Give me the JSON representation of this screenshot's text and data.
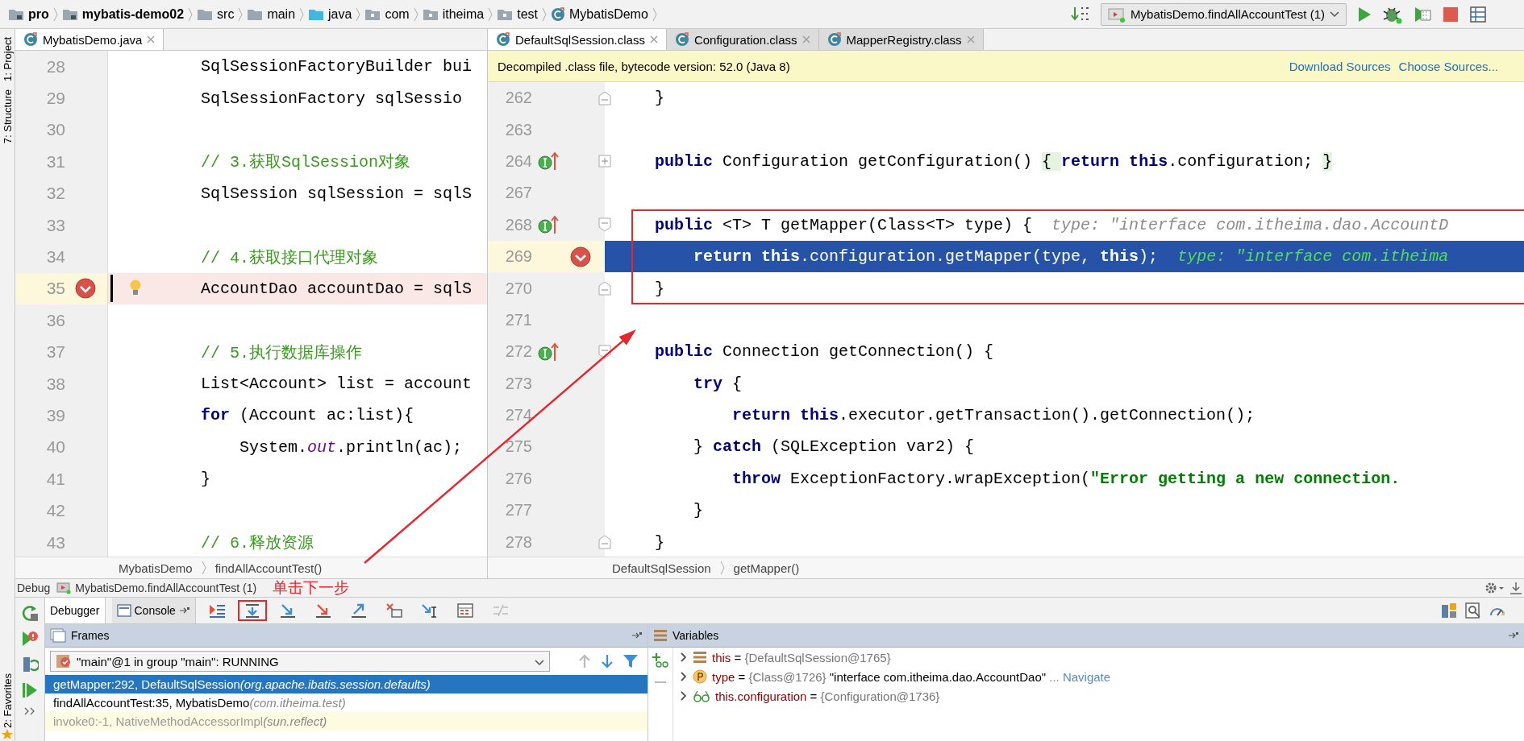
{
  "breadcrumbs": [
    {
      "label": "pro",
      "kind": "module"
    },
    {
      "label": "mybatis-demo02",
      "kind": "module"
    },
    {
      "label": "src",
      "kind": "folder"
    },
    {
      "label": "main",
      "kind": "folder"
    },
    {
      "label": "java",
      "kind": "source"
    },
    {
      "label": "com",
      "kind": "package"
    },
    {
      "label": "itheima",
      "kind": "package"
    },
    {
      "label": "test",
      "kind": "package"
    },
    {
      "label": "MybatisDemo",
      "kind": "class"
    }
  ],
  "run_config": {
    "label": "MybatisDemo.findAllAccountTest (1)"
  },
  "tool_strip": {
    "top": [
      "1: Project",
      "7: Structure"
    ],
    "bottom": [
      "2: Favorites"
    ]
  },
  "left_editor": {
    "tabs": [
      {
        "label": "MybatisDemo.java",
        "selected": true
      }
    ],
    "lines": [
      {
        "number": "28",
        "breakpoint": false,
        "current": false,
        "tokens": [
          {
            "kind": "plain",
            "text": "SqlSessionFactoryBuilder bui"
          }
        ]
      },
      {
        "number": "29",
        "breakpoint": false,
        "current": false,
        "tokens": [
          {
            "kind": "plain",
            "text": "SqlSessionFactory sqlSessio"
          }
        ]
      },
      {
        "number": "30",
        "breakpoint": false,
        "current": false
      },
      {
        "number": "31",
        "breakpoint": false,
        "current": false,
        "tokens": [
          {
            "kind": "comment",
            "text": "// 3.获取SqlSession对象"
          }
        ]
      },
      {
        "number": "32",
        "breakpoint": false,
        "current": false,
        "tokens": [
          {
            "kind": "plain",
            "text": "SqlSession sqlSession = sqlS"
          }
        ]
      },
      {
        "number": "33",
        "breakpoint": false,
        "current": false
      },
      {
        "number": "34",
        "breakpoint": false,
        "current": false,
        "tokens": [
          {
            "kind": "comment",
            "text": "// 4.获取接口代理对象"
          }
        ]
      },
      {
        "number": "35",
        "breakpoint": true,
        "current": true,
        "bulb": true,
        "tokens": [
          {
            "kind": "plain",
            "text": "AccountDao accountDao = sqlS"
          }
        ]
      },
      {
        "number": "36",
        "breakpoint": false,
        "current": false
      },
      {
        "number": "37",
        "breakpoint": false,
        "current": false,
        "tokens": [
          {
            "kind": "comment",
            "text": "// 5.执行数据库操作"
          }
        ]
      },
      {
        "number": "38",
        "breakpoint": false,
        "current": false,
        "tokens": [
          {
            "kind": "plain",
            "text": "List<Account> list = account"
          }
        ]
      },
      {
        "number": "39",
        "breakpoint": false,
        "current": false,
        "tokens": [
          {
            "kind": "keyword",
            "text": "for"
          },
          {
            "kind": "plain",
            "text": " (Account ac:list){"
          }
        ]
      },
      {
        "number": "40",
        "breakpoint": false,
        "current": false,
        "tokens": [
          {
            "kind": "plain",
            "text": "    System."
          },
          {
            "kind": "static",
            "text": "out"
          },
          {
            "kind": "plain",
            "text": ".println(ac);"
          }
        ]
      },
      {
        "number": "41",
        "breakpoint": false,
        "current": false,
        "tokens": [
          {
            "kind": "plain",
            "text": "}"
          }
        ]
      },
      {
        "number": "42",
        "breakpoint": false,
        "current": false
      },
      {
        "number": "43",
        "breakpoint": false,
        "current": false,
        "tokens": [
          {
            "kind": "comment",
            "text": "// 6.释放资源"
          }
        ]
      }
    ],
    "breadcrumb": [
      "MybatisDemo",
      "findAllAccountTest()"
    ]
  },
  "right_editor": {
    "tabs": [
      {
        "label": "DefaultSqlSession.class",
        "selected": true
      },
      {
        "label": "Configuration.class",
        "selected": false
      },
      {
        "label": "MapperRegistry.class",
        "selected": false
      }
    ],
    "banner": {
      "text": "Decompiled .class file, bytecode version: 52.0 (Java 8)",
      "links": [
        "Download Sources",
        "Choose Sources..."
      ]
    },
    "lines": [
      {
        "number": "262",
        "breakpoint": false,
        "current": false,
        "boxed": false,
        "fold_end": true,
        "tokens": [
          {
            "kind": "plain",
            "text": "}"
          }
        ]
      },
      {
        "number": "263",
        "breakpoint": false,
        "current": false,
        "boxed": false
      },
      {
        "number": "264",
        "breakpoint": false,
        "current": false,
        "boxed": false,
        "implemented": true,
        "collapsed": true,
        "tokens": [
          {
            "kind": "keyword",
            "text": "public"
          },
          {
            "kind": "plain",
            "text": " Configuration getConfiguration() "
          },
          {
            "kind": "brace",
            "text": "{ "
          },
          {
            "kind": "keyword",
            "text": "return this"
          },
          {
            "kind": "plain",
            "text": ".configuration; "
          },
          {
            "kind": "brace",
            "text": "}"
          }
        ]
      },
      {
        "number": "267",
        "breakpoint": false,
        "current": false,
        "boxed": false
      },
      {
        "number": "268",
        "breakpoint": false,
        "current": false,
        "boxed": true,
        "implemented": true,
        "fold_start": true,
        "tokens": [
          {
            "kind": "keyword",
            "text": "public"
          },
          {
            "kind": "plain",
            "text": " <T> T getMapper(Class<T> type) {"
          },
          {
            "kind": "hint",
            "text": "  type: \"interface com.itheima.dao.AccountD"
          }
        ]
      },
      {
        "number": "269",
        "breakpoint": true,
        "current": true,
        "boxed": true,
        "tokens": [
          {
            "kind": "keyword",
            "text": "    return this"
          },
          {
            "kind": "plain",
            "text": ".configuration.getMapper(type, "
          },
          {
            "kind": "keyword",
            "text": "this"
          },
          {
            "kind": "plain",
            "text": ");"
          },
          {
            "kind": "hint",
            "text": "  type: \"interface com.itheima"
          }
        ]
      },
      {
        "number": "270",
        "breakpoint": false,
        "current": false,
        "boxed": true,
        "fold_end": true,
        "tokens": [
          {
            "kind": "plain",
            "text": "}"
          }
        ]
      },
      {
        "number": "271",
        "breakpoint": false,
        "current": false,
        "boxed": false
      },
      {
        "number": "272",
        "breakpoint": false,
        "current": false,
        "boxed": false,
        "implemented": true,
        "fold_start": true,
        "tokens": [
          {
            "kind": "keyword",
            "text": "public"
          },
          {
            "kind": "plain",
            "text": " Connection getConnection() {"
          }
        ]
      },
      {
        "number": "273",
        "breakpoint": false,
        "current": false,
        "boxed": false,
        "tokens": [
          {
            "kind": "keyword",
            "text": "    try"
          },
          {
            "kind": "plain",
            "text": " {"
          }
        ]
      },
      {
        "number": "274",
        "breakpoint": false,
        "current": false,
        "boxed": false,
        "tokens": [
          {
            "kind": "keyword",
            "text": "        return this"
          },
          {
            "kind": "plain",
            "text": ".executor.getTransaction().getConnection();"
          }
        ]
      },
      {
        "number": "275",
        "breakpoint": false,
        "current": false,
        "boxed": false,
        "tokens": [
          {
            "kind": "plain",
            "text": "    } "
          },
          {
            "kind": "keyword",
            "text": "catch"
          },
          {
            "kind": "plain",
            "text": " (SQLException var2) {"
          }
        ]
      },
      {
        "number": "276",
        "breakpoint": false,
        "current": false,
        "boxed": false,
        "tokens": [
          {
            "kind": "keyword",
            "text": "        throw"
          },
          {
            "kind": "plain",
            "text": " ExceptionFactory.wrapException("
          },
          {
            "kind": "string",
            "text": "\"Error getting a new connection."
          }
        ]
      },
      {
        "number": "277",
        "breakpoint": false,
        "current": false,
        "boxed": false,
        "tokens": [
          {
            "kind": "plain",
            "text": "    }"
          }
        ]
      },
      {
        "number": "278",
        "breakpoint": false,
        "current": false,
        "boxed": false,
        "fold_end": true,
        "tokens": [
          {
            "kind": "plain",
            "text": "}"
          }
        ]
      }
    ],
    "breadcrumb": [
      "DefaultSqlSession",
      "getMapper()"
    ]
  },
  "debug": {
    "title": "Debug",
    "session": "MybatisDemo.findAllAccountTest (1)",
    "note": "单击下一步",
    "tabs": [
      {
        "label": "Debugger",
        "selected": true
      },
      {
        "label": "Console",
        "selected": false
      }
    ],
    "steps": [
      {
        "kind": "show-execution-point",
        "boxed": false
      },
      {
        "kind": "step-over",
        "boxed": true
      },
      {
        "kind": "step-into",
        "boxed": false
      },
      {
        "kind": "force-step-into",
        "boxed": false
      },
      {
        "kind": "step-out",
        "boxed": false
      },
      {
        "kind": "drop-frame",
        "boxed": false
      },
      {
        "kind": "run-to-cursor",
        "boxed": false
      },
      {
        "kind": "evaluate",
        "boxed": false
      },
      {
        "kind": "trace",
        "boxed": false
      }
    ],
    "frames": {
      "title": "Frames",
      "thread": "\"main\"@1 in group \"main\": RUNNING",
      "items": [
        {
          "method": "getMapper:292, DefaultSqlSession",
          "package": "(org.apache.ibatis.session.defaults)",
          "selected": true,
          "library": false
        },
        {
          "method": "findAllAccountTest:35, MybatisDemo",
          "package": "(com.itheima.test)",
          "selected": false,
          "library": false
        },
        {
          "method": "invoke0:-1, NativeMethodAccessorImpl",
          "package": "(sun.reflect)",
          "selected": false,
          "library": true
        }
      ]
    },
    "variables": {
      "title": "Variables",
      "items": [
        {
          "kind": "field",
          "name": "this",
          "operator": "=",
          "value": "{DefaultSqlSession@1765}"
        },
        {
          "kind": "param",
          "name": "type",
          "operator": "=",
          "value": "{Class@1726}",
          "text": "\"interface com.itheima.dao.AccountDao\"",
          "link": "... Navigate"
        },
        {
          "kind": "watch",
          "name": "this.configuration",
          "operator": "=",
          "value": "{Configuration@1736}"
        }
      ]
    }
  }
}
